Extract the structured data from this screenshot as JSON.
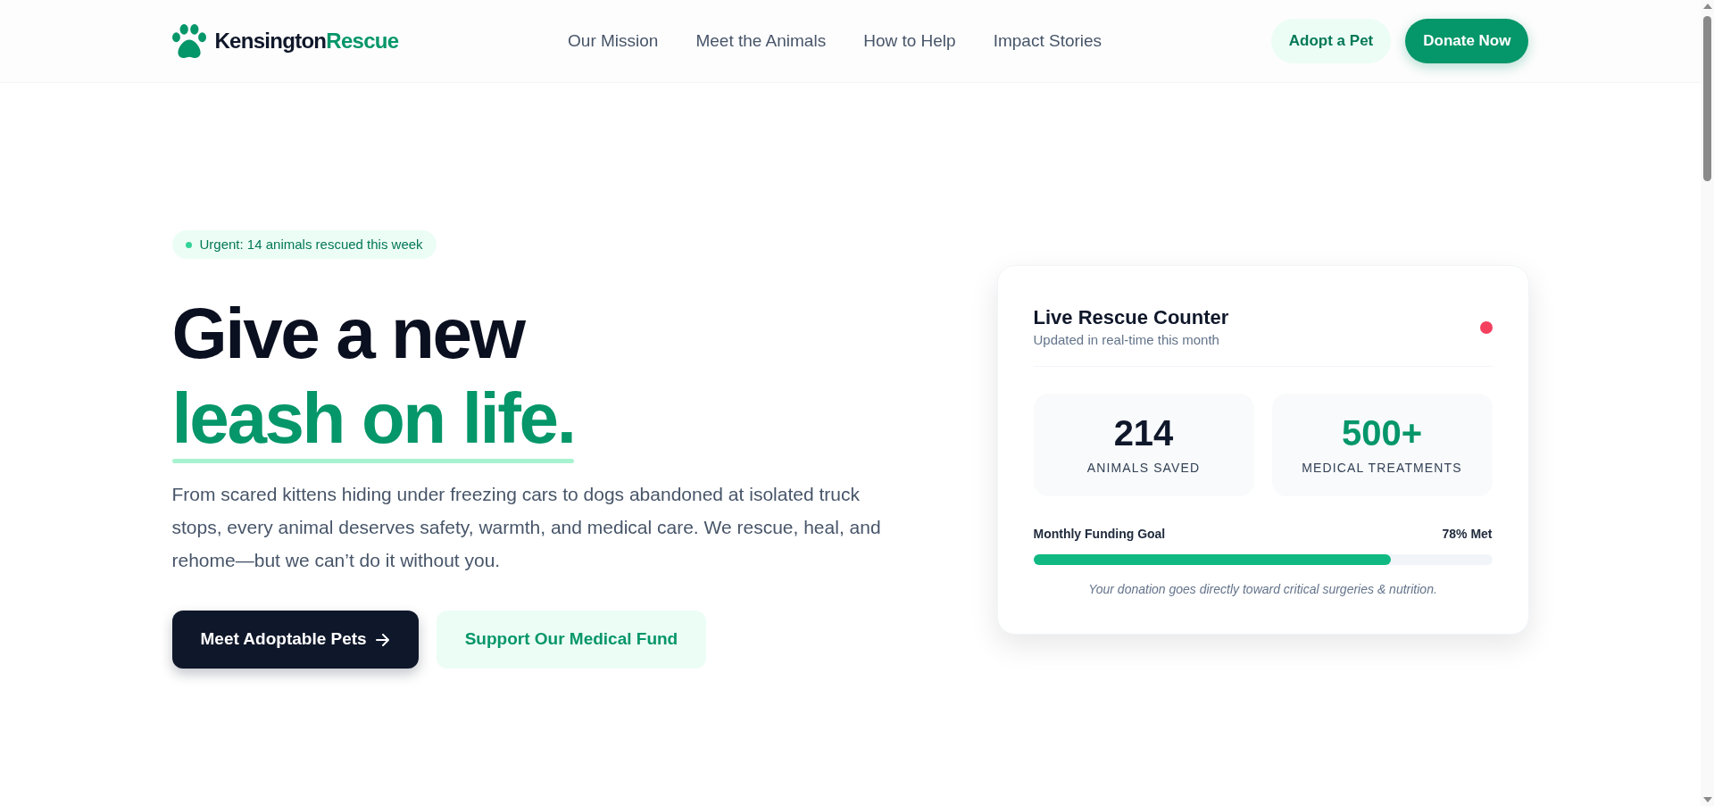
{
  "header": {
    "logo": {
      "text": "Kensington",
      "accent": "Rescue"
    },
    "nav": [
      "Our Mission",
      "Meet the Animals",
      "How to Help",
      "Impact Stories"
    ],
    "actions": [
      {
        "label": "Adopt a Pet",
        "kind": "secondary"
      },
      {
        "label": "Donate Now",
        "kind": "primary"
      }
    ]
  },
  "hero": {
    "badge": "Urgent: 14 animals rescued this week",
    "headline": {
      "text": "Give a new",
      "highlight": "leash on life."
    },
    "body": "From scared kittens hiding under freezing cars to dogs abandoned at isolated truck stops, every animal deserves safety, warmth, and medical care. We rescue, heal, and rehome—but we can’t do it without you.",
    "buttons": [
      {
        "label": "Meet Adoptable Pets",
        "kind": "dark",
        "arrow": true
      },
      {
        "label": "Support Our Medical Fund",
        "kind": "soft",
        "arrow": false
      }
    ]
  },
  "counter_card": {
    "title": "Live Rescue Counter",
    "subtitle": "Updated in real-time this month",
    "stats": [
      {
        "value": "214",
        "label": "ANIMALS SAVED",
        "color": "#0f172a"
      },
      {
        "value": "500+",
        "label": "MEDICAL TREATMENTS",
        "color": "#059669"
      }
    ],
    "funding": {
      "label": "Monthly Funding Goal",
      "reading": "78% Met",
      "level": 0.78
    },
    "note": "Your donation goes directly toward critical surgeries & nutrition."
  }
}
